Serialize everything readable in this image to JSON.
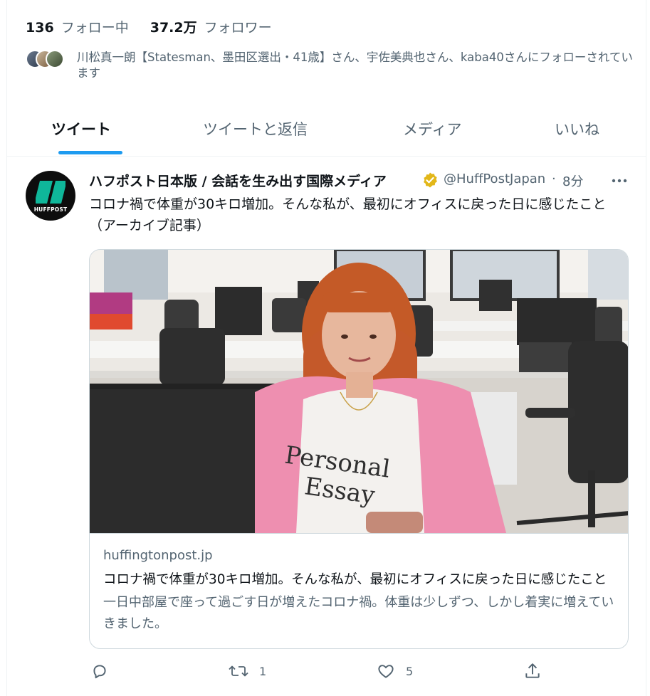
{
  "profile_stats": {
    "following_count": "136",
    "following_label": "フォロー中",
    "followers_count": "37.2万",
    "followers_label": "フォロワー"
  },
  "followed_by_text": "川松真一朗【Statesman、墨田区選出・41歳】さん、宇佐美典也さん、kaba40さんにフォローされています",
  "tabs": [
    {
      "label": "ツイート",
      "active": true
    },
    {
      "label": "ツイートと返信",
      "active": false
    },
    {
      "label": "メディア",
      "active": false
    },
    {
      "label": "いいね",
      "active": false
    }
  ],
  "tweet": {
    "avatar_text": "HUFFPOST",
    "author_name": "ハフポスト日本版 / 会話を生み出す国際メディア",
    "handle": "@HuffPostJapan",
    "separator": "·",
    "time": "8分",
    "text": "コロナ禍で体重が30キロ増加。そんな私が、最初にオフィスに戻った日に感じたこと（アーカイブ記事）",
    "card": {
      "image_shirt_text_line1": "Personal",
      "image_shirt_text_line2": "Essay",
      "domain": "huffingtonpost.jp",
      "title": "コロナ禍で体重が30キロ増加。そんな私が、最初にオフィスに戻った日に感じたこと",
      "description": "一日中部屋で座って過ごす日が増えたコロナ禍。体重は少しずつ、しかし着実に増えていきました。"
    },
    "actions": {
      "reply_count": "",
      "retweet_count": "1",
      "like_count": "5"
    }
  },
  "colors": {
    "accent": "#1d9bf0",
    "text_primary": "#0f1419",
    "text_secondary": "#536471",
    "border": "#cfd9de",
    "verified_gold": "#e2b719"
  },
  "icons": [
    "reply-icon",
    "retweet-icon",
    "like-icon",
    "share-icon",
    "more-icon",
    "verified-badge-icon"
  ]
}
